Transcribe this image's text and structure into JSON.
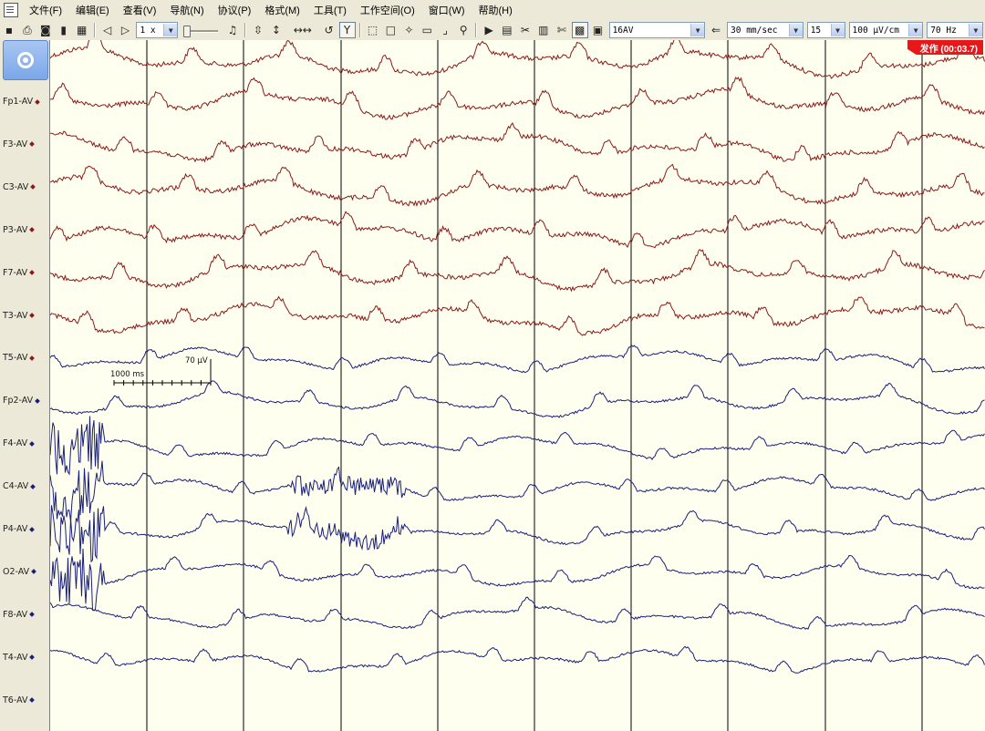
{
  "menu": {
    "items": [
      "文件(F)",
      "编辑(E)",
      "查看(V)",
      "导航(N)",
      "协议(P)",
      "格式(M)",
      "工具(T)",
      "工作空间(O)",
      "窗口(W)",
      "帮助(H)"
    ]
  },
  "toolbar": {
    "speed": "1 x",
    "montage": "16AV",
    "paper_speed": "30 mm/sec",
    "page_length": "15",
    "sensitivity": "100 μV/cm",
    "high_filter": "70 Hz"
  },
  "event": {
    "label": "发作 (00:03.7)",
    "color": "#E8181A"
  },
  "scale_bar": {
    "time_label": "1000 ms",
    "amp_label": "70 μV"
  },
  "channels": [
    {
      "label": "Fp1-AV",
      "hemisphere": "left"
    },
    {
      "label": "F3-AV",
      "hemisphere": "left"
    },
    {
      "label": "C3-AV",
      "hemisphere": "left"
    },
    {
      "label": "P3-AV",
      "hemisphere": "left"
    },
    {
      "label": "F7-AV",
      "hemisphere": "left"
    },
    {
      "label": "T3-AV",
      "hemisphere": "left"
    },
    {
      "label": "T5-AV",
      "hemisphere": "left"
    },
    {
      "label": "Fp2-AV",
      "hemisphere": "right"
    },
    {
      "label": "F4-AV",
      "hemisphere": "right"
    },
    {
      "label": "C4-AV",
      "hemisphere": "right"
    },
    {
      "label": "P4-AV",
      "hemisphere": "right"
    },
    {
      "label": "O2-AV",
      "hemisphere": "right"
    },
    {
      "label": "F8-AV",
      "hemisphere": "right"
    },
    {
      "label": "T4-AV",
      "hemisphere": "right"
    },
    {
      "label": "T6-AV",
      "hemisphere": "right"
    }
  ],
  "colors": {
    "left": "#8B1A1A",
    "right": "#1A1F7A",
    "background": "#FFFFF0",
    "second_lines": "#000000"
  },
  "icons": {
    "toolbar_left": [
      "save-icon",
      "print-icon",
      "camera-icon",
      "lock-icon",
      "scan-icon"
    ],
    "playback": [
      "step-back-icon",
      "play-icon"
    ],
    "tools": [
      "audio-icon",
      "amp-scale-icon",
      "amp-scale-2-icon",
      "time-scale-icon",
      "undo-icon",
      "filter-icon",
      "select-rect-icon",
      "select-dotted-icon",
      "marker-icon",
      "ruler-icon",
      "bracket-icon",
      "zoom-icon",
      "video-icon",
      "montage-icon",
      "settings-tools-icon",
      "calculator-icon",
      "scissors-icon",
      "film-icon",
      "window-icon",
      "back-arrow-icon"
    ]
  }
}
